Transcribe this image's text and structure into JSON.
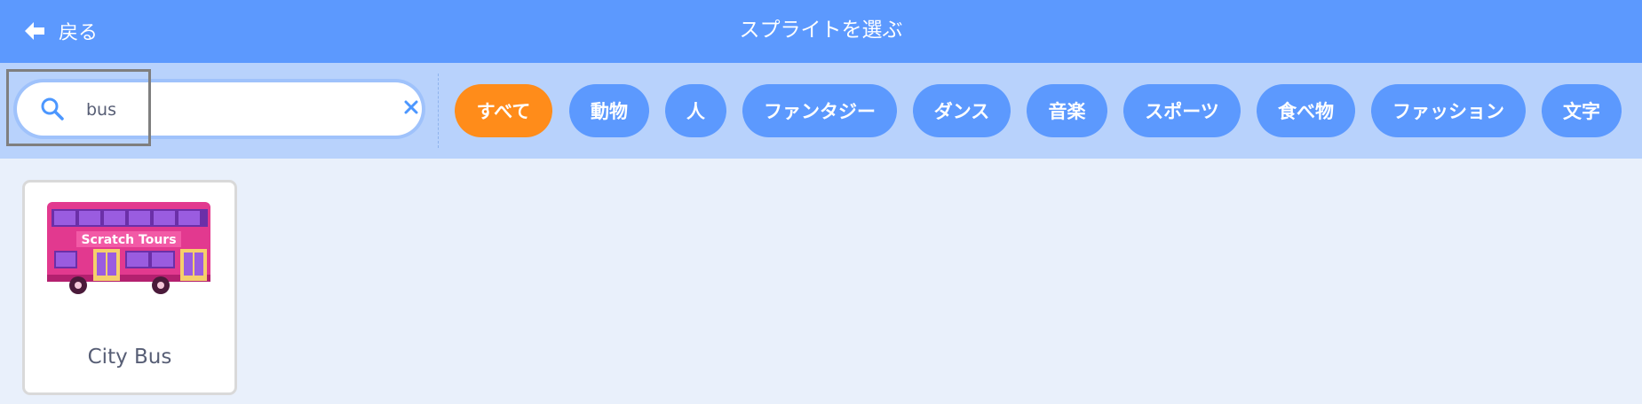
{
  "header": {
    "back_label": "戻る",
    "title": "スプライトを選ぶ"
  },
  "search": {
    "value": "bus",
    "placeholder": ""
  },
  "tags": [
    {
      "label": "すべて",
      "active": true
    },
    {
      "label": "動物",
      "active": false
    },
    {
      "label": "人",
      "active": false
    },
    {
      "label": "ファンタジー",
      "active": false
    },
    {
      "label": "ダンス",
      "active": false
    },
    {
      "label": "音楽",
      "active": false
    },
    {
      "label": "スポーツ",
      "active": false
    },
    {
      "label": "食べ物",
      "active": false
    },
    {
      "label": "ファッション",
      "active": false
    },
    {
      "label": "文字",
      "active": false
    }
  ],
  "sprites": [
    {
      "name": "City Bus",
      "sign_text": "Scratch Tours"
    }
  ],
  "colors": {
    "header": "#5c99fe",
    "toolbar": "#b8d2fc",
    "background": "#e9f0fb",
    "tag": "#5c99fe",
    "tag_active": "#ff8c1a",
    "bus_body": "#e2398f",
    "bus_window": "#9a5ce0"
  },
  "icons": {
    "back": "arrow-left-icon",
    "search": "search-icon",
    "clear": "close-icon"
  }
}
